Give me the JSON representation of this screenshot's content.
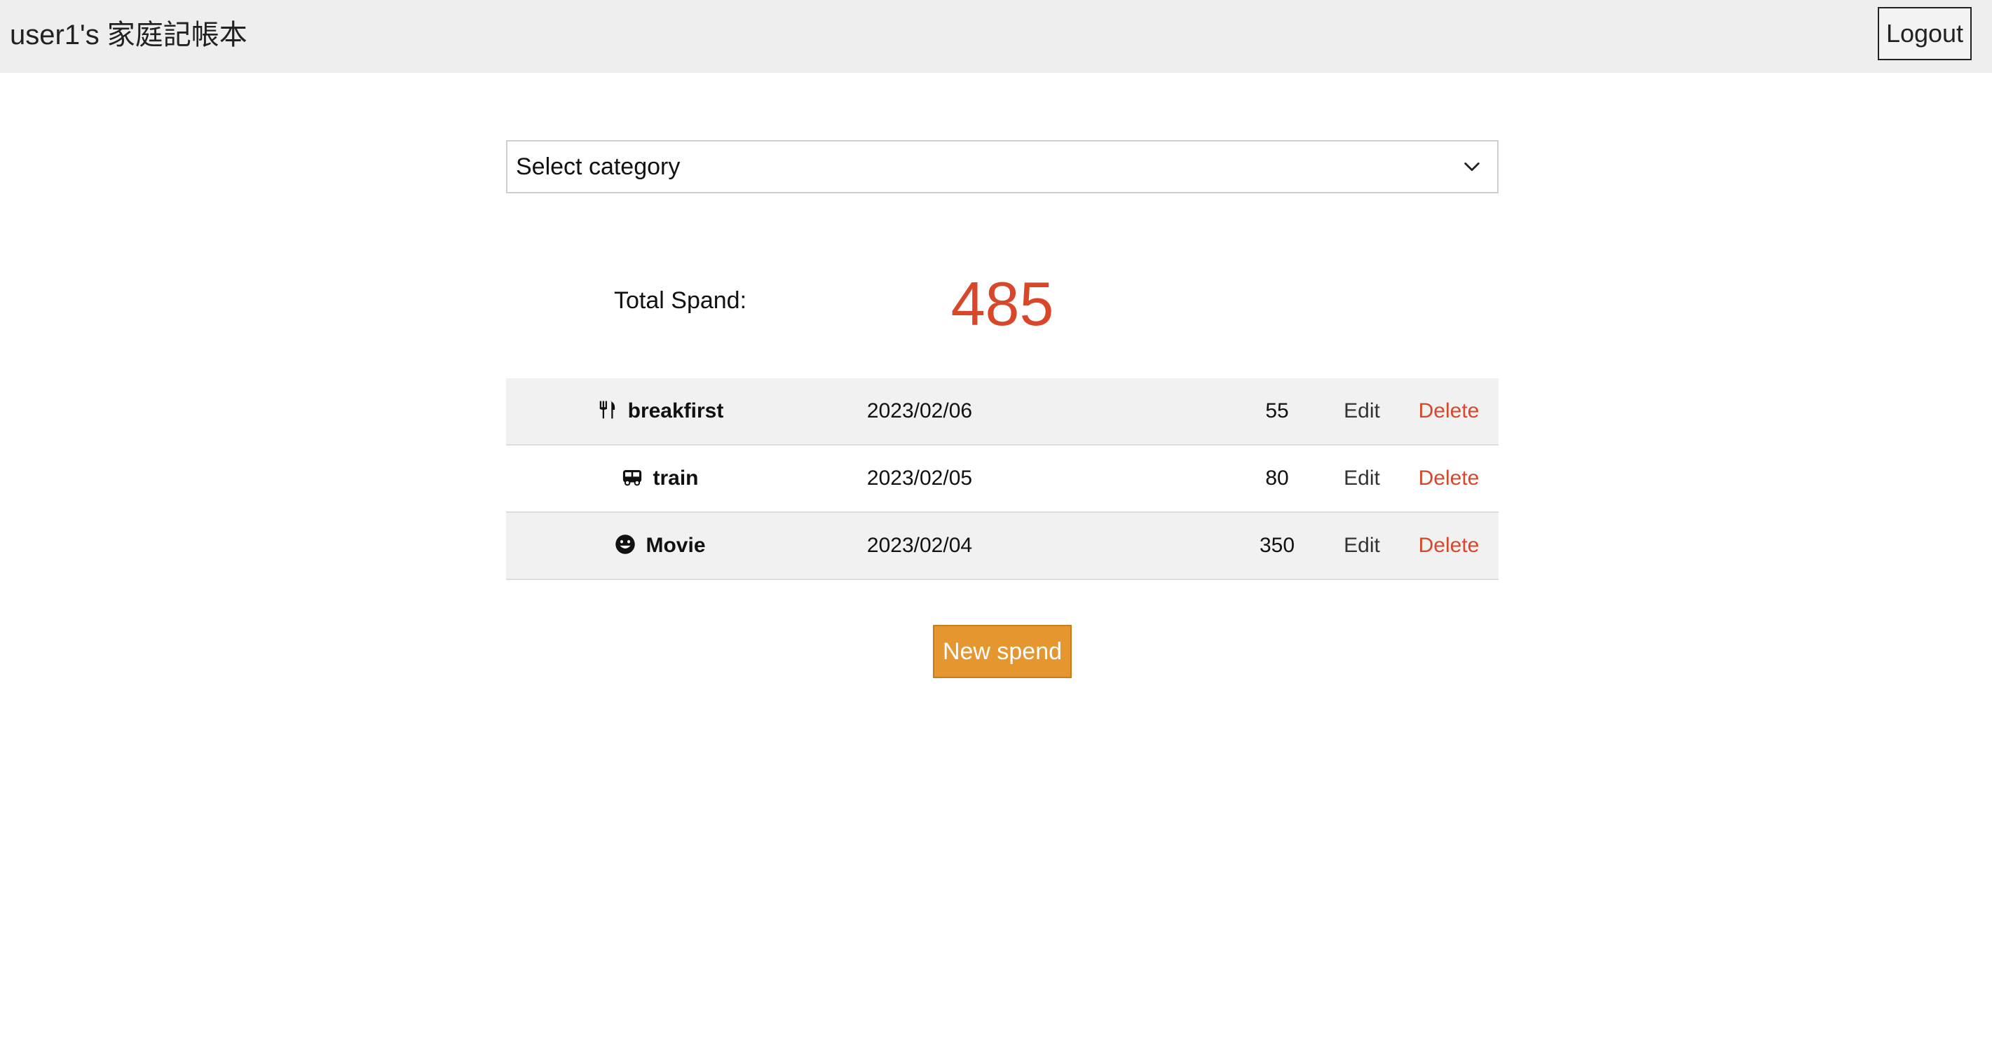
{
  "header": {
    "title": "user1's 家庭記帳本",
    "logout_label": "Logout"
  },
  "filter": {
    "selected": "Select category"
  },
  "summary": {
    "label": "Total Spand:",
    "total": "485"
  },
  "spends": [
    {
      "icon": "utensils-icon",
      "name": "breakfirst",
      "date": "2023/02/06",
      "amount": "55",
      "edit": "Edit",
      "delete": "Delete"
    },
    {
      "icon": "bus-icon",
      "name": "train",
      "date": "2023/02/05",
      "amount": "80",
      "edit": "Edit",
      "delete": "Delete"
    },
    {
      "icon": "smile-icon",
      "name": "Movie",
      "date": "2023/02/04",
      "amount": "350",
      "edit": "Edit",
      "delete": "Delete"
    }
  ],
  "actions": {
    "new_spend_label": "New spend"
  },
  "colors": {
    "accent_red": "#d9472b",
    "button_orange": "#e5962e",
    "header_bg": "#eeeeee"
  }
}
